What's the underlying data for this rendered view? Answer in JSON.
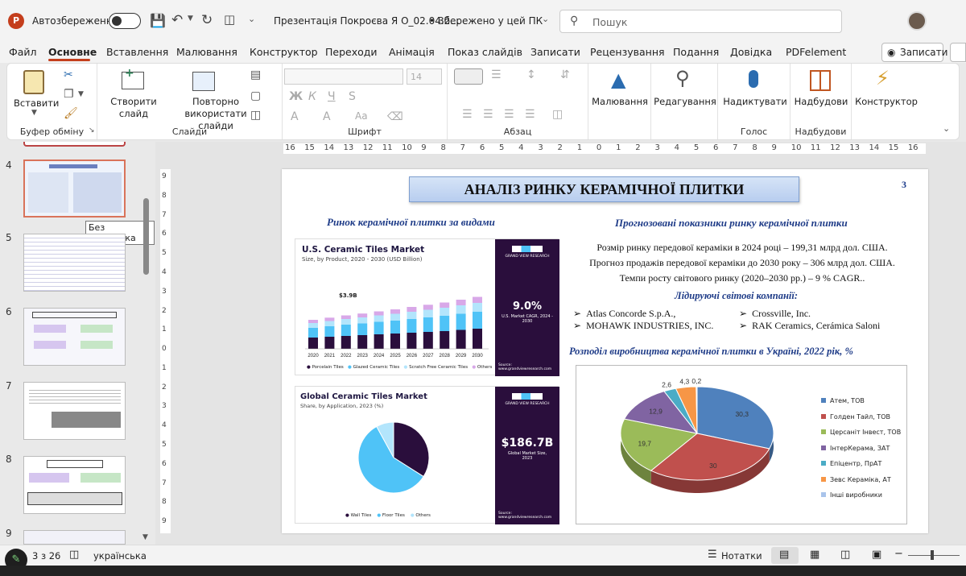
{
  "titlebar": {
    "autosave_label": "Автозбереження",
    "doc_title": "Презентація Покроєва Я О_02.04.2...",
    "save_status": "• Збережено у цей ПК",
    "search_placeholder": "Пошук"
  },
  "menu": {
    "items": [
      "Файл",
      "Основне",
      "Вставлення",
      "Малювання",
      "Конструктор",
      "Переходи",
      "Анімація",
      "Показ слайдів",
      "Записати",
      "Рецензування",
      "Подання",
      "Довідка",
      "PDFelement"
    ],
    "record_button": "Записати"
  },
  "ribbon": {
    "paste": "Вставити",
    "clipboard_group": "Буфер обміну",
    "new_slide": "Створити слайд",
    "reuse_slides": "Повторно використати слайди",
    "slides_group": "Слайди",
    "font_size": "14",
    "font_group": "Шрифт",
    "paragraph_group": "Абзац",
    "drawing": "Малювання",
    "editing": "Редагування",
    "dictate": "Надиктувати",
    "voice_group": "Голос",
    "addins": "Надбудови",
    "addins_group": "Надбудови",
    "designer": "Конструктор"
  },
  "thumbnails": {
    "numbers": [
      "4",
      "5",
      "6",
      "7",
      "8",
      "9"
    ],
    "tooltip": "Без заголовка"
  },
  "ruler": {
    "h_ticks": [
      "16",
      "15",
      "14",
      "13",
      "12",
      "11",
      "10",
      "9",
      "8",
      "7",
      "6",
      "5",
      "4",
      "3",
      "2",
      "1",
      "0",
      "1",
      "2",
      "3",
      "4",
      "5",
      "6",
      "7",
      "8",
      "9",
      "10",
      "11",
      "12",
      "13",
      "14",
      "15",
      "16"
    ],
    "v_ticks": [
      "9",
      "8",
      "7",
      "6",
      "5",
      "4",
      "3",
      "2",
      "1",
      "0",
      "1",
      "2",
      "3",
      "4",
      "5",
      "6",
      "7",
      "8",
      "9"
    ]
  },
  "slide": {
    "title": "АНАЛІЗ РИНКУ КЕРАМІЧНОЇ ПЛИТКИ",
    "page_number": "3",
    "left_heading": "Ринок керамічної плитки за видами",
    "right_heading": "Прогнозовані  показники ринку керамічної плитки",
    "forecast_lines": [
      "Розмір ринку передової кераміки в 2024 році – 199,31 млрд дол. США.",
      "Прогноз продажів передової кераміки до 2030 року – 306 млрд дол. США.",
      "Темпи росту світового ринку (2020–2030 рр.) – 9 % CAGR.."
    ],
    "leaders_heading": "Лідируючі світові компанії:",
    "leaders_left": [
      "Atlas Concorde S.p.A.,",
      "MOHAWK INDUSTRIES, INC."
    ],
    "leaders_right": [
      "Crossville, Inc.",
      "RAK Ceramics, Cerámica Saloni"
    ],
    "ukraine_heading": "Розподіл виробництва керамічної плитки в Україні, 2022 рік, %"
  },
  "us_market": {
    "title": "U.S. Ceramic Tiles Market",
    "subtitle": "Size, by Product, 2020 - 2030 (USD Billion)",
    "first_value_label": "$3.9B",
    "brand": "GRAND VIEW RESEARCH",
    "cagr": "9.0%",
    "cagr_caption": "U.S. Market CAGR, 2024 - 2030",
    "source": "Source: www.grandviewresearch.com",
    "legend": [
      "Porcelain Tiles",
      "Glazed Ceramic Tiles",
      "Scratch Free Ceramic Tiles",
      "Others"
    ]
  },
  "global_market": {
    "title": "Global Ceramic Tiles Market",
    "subtitle": "Share, by Application, 2023 (%)",
    "brand": "GRAND VIEW RESEARCH",
    "size": "$186.7B",
    "size_caption": "Global Market Size, 2023",
    "source": "Source: www.grandviewresearch.com",
    "legend": [
      "Wall Tiles",
      "Floor Tiles",
      "Others"
    ]
  },
  "status": {
    "slide_of": "3 з 26",
    "language": "українська",
    "notes": "Нотатки"
  },
  "colors": {
    "accent_red": "#c43e1c",
    "dark_purple": "#2a0e3c",
    "blue": "#3b67b8"
  },
  "chart_data": [
    {
      "type": "bar",
      "title": "U.S. Ceramic Tiles Market",
      "categories": [
        "2020",
        "2021",
        "2022",
        "2023",
        "2024",
        "2025",
        "2026",
        "2027",
        "2028",
        "2029",
        "2030"
      ],
      "series": [
        {
          "name": "Porcelain Tiles",
          "values": [
            1.4,
            1.5,
            1.6,
            1.7,
            1.8,
            1.9,
            2.0,
            2.1,
            2.2,
            2.35,
            2.5
          ]
        },
        {
          "name": "Glazed Ceramic Tiles",
          "values": [
            1.2,
            1.3,
            1.4,
            1.45,
            1.55,
            1.6,
            1.7,
            1.8,
            1.9,
            2.0,
            2.1
          ]
        },
        {
          "name": "Scratch Free Ceramic Tiles",
          "values": [
            0.6,
            0.65,
            0.7,
            0.75,
            0.8,
            0.85,
            0.9,
            0.95,
            1.0,
            1.05,
            1.1
          ]
        },
        {
          "name": "Others",
          "values": [
            0.4,
            0.42,
            0.45,
            0.48,
            0.5,
            0.55,
            0.6,
            0.62,
            0.65,
            0.7,
            0.75
          ]
        }
      ]
    },
    {
      "type": "pie",
      "title": "Global Ceramic Tiles Market",
      "labels": [
        "Wall Tiles",
        "Floor Tiles",
        "Others"
      ],
      "values": [
        34,
        58,
        8
      ]
    },
    {
      "type": "pie",
      "title": "Розподіл виробництва керамічної плитки в Україні, 2022 рік, %",
      "labels": [
        "Атем, ТОВ",
        "Голден Тайл, ТОВ",
        "Церсаніт Інвест, ТОВ",
        "ІнтерКерама, ЗАТ",
        "Епіцентр, ПрАТ",
        "Зевс Кераміка, АТ",
        "Інші виробники"
      ],
      "values": [
        30.3,
        30,
        19.7,
        12.9,
        2.6,
        4.3,
        0.2
      ],
      "value_labels": [
        "30,3",
        "30",
        "19,7",
        "12,9",
        "2,6",
        "4,3",
        "0,2"
      ],
      "colors": [
        "#4f81bd",
        "#c0504d",
        "#9bbb59",
        "#8064a2",
        "#4bacc6",
        "#f79646",
        "#a9c4eb"
      ]
    }
  ]
}
